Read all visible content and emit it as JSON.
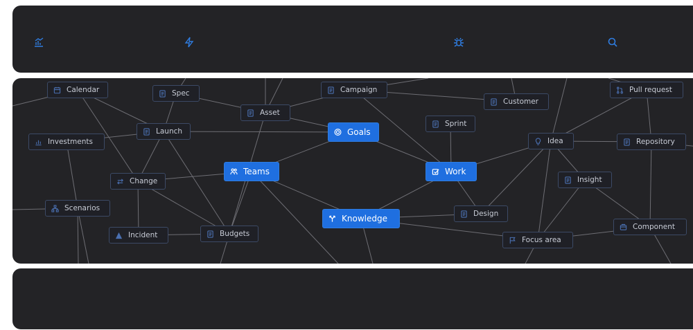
{
  "toolbar": {
    "icons": [
      "analytics-icon",
      "lightning-icon",
      "bug-icon",
      "search-icon"
    ]
  },
  "colors": {
    "background": "#232326",
    "accent": "#1f6fe0",
    "edge": "#6e6e74",
    "node_border": "#3c4a66"
  },
  "graph": {
    "nodes": [
      {
        "id": "calendar",
        "label": "Calendar",
        "icon": "calendar-icon"
      },
      {
        "id": "spec",
        "label": "Spec",
        "icon": "document-icon"
      },
      {
        "id": "campaign",
        "label": "Campaign",
        "icon": "document-icon"
      },
      {
        "id": "customer",
        "label": "Customer",
        "icon": "document-icon"
      },
      {
        "id": "pull_request",
        "label": "Pull request",
        "icon": "pull-request-icon"
      },
      {
        "id": "asset",
        "label": "Asset",
        "icon": "document-icon"
      },
      {
        "id": "investments",
        "label": "Investments",
        "icon": "chart-icon"
      },
      {
        "id": "launch",
        "label": "Launch",
        "icon": "document-icon"
      },
      {
        "id": "goals",
        "label": "Goals",
        "icon": "target-icon",
        "primary": true
      },
      {
        "id": "sprint",
        "label": "Sprint",
        "icon": "document-icon"
      },
      {
        "id": "idea",
        "label": "Idea",
        "icon": "lightbulb-icon"
      },
      {
        "id": "repository",
        "label": "Repository",
        "icon": "document-icon"
      },
      {
        "id": "teams",
        "label": "Teams",
        "icon": "team-icon",
        "primary": true
      },
      {
        "id": "work",
        "label": "Work",
        "icon": "checkbox-icon",
        "primary": true
      },
      {
        "id": "change",
        "label": "Change",
        "icon": "arrows-icon"
      },
      {
        "id": "insight",
        "label": "Insight",
        "icon": "document-icon"
      },
      {
        "id": "scenarios",
        "label": "Scenarios",
        "icon": "hierarchy-icon"
      },
      {
        "id": "knowledge",
        "label": "Knowledge",
        "icon": "branch-icon",
        "primary": true
      },
      {
        "id": "design",
        "label": "Design",
        "icon": "document-icon"
      },
      {
        "id": "component",
        "label": "Component",
        "icon": "component-icon"
      },
      {
        "id": "incident",
        "label": "Incident",
        "icon": "warning-icon"
      },
      {
        "id": "budgets",
        "label": "Budgets",
        "icon": "document-icon"
      },
      {
        "id": "focus_area",
        "label": "Focus area",
        "icon": "flag-icon"
      }
    ],
    "edges": [
      [
        "calendar",
        "launch"
      ],
      [
        "calendar",
        "change"
      ],
      [
        "spec",
        "asset"
      ],
      [
        "spec",
        "launch"
      ],
      [
        "asset",
        "campaign"
      ],
      [
        "asset",
        "goals"
      ],
      [
        "asset",
        "budgets"
      ],
      [
        "campaign",
        "customer"
      ],
      [
        "campaign",
        "work"
      ],
      [
        "launch",
        "investments"
      ],
      [
        "launch",
        "goals"
      ],
      [
        "launch",
        "budgets"
      ],
      [
        "launch",
        "change"
      ],
      [
        "goals",
        "teams"
      ],
      [
        "goals",
        "work"
      ],
      [
        "sprint",
        "work"
      ],
      [
        "teams",
        "change"
      ],
      [
        "teams",
        "knowledge"
      ],
      [
        "teams",
        "budgets"
      ],
      [
        "work",
        "knowledge"
      ],
      [
        "work",
        "idea"
      ],
      [
        "work",
        "design"
      ],
      [
        "idea",
        "pull_request"
      ],
      [
        "idea",
        "repository"
      ],
      [
        "idea",
        "insight"
      ],
      [
        "idea",
        "focus_area"
      ],
      [
        "idea",
        "design"
      ],
      [
        "pull_request",
        "repository"
      ],
      [
        "repository",
        "component"
      ],
      [
        "insight",
        "component"
      ],
      [
        "insight",
        "focus_area"
      ],
      [
        "knowledge",
        "design"
      ],
      [
        "knowledge",
        "focus_area"
      ],
      [
        "focus_area",
        "component"
      ],
      [
        "change",
        "incident"
      ],
      [
        "change",
        "budgets"
      ],
      [
        "incident",
        "budgets"
      ],
      [
        "investments",
        "scenarios"
      ]
    ]
  }
}
